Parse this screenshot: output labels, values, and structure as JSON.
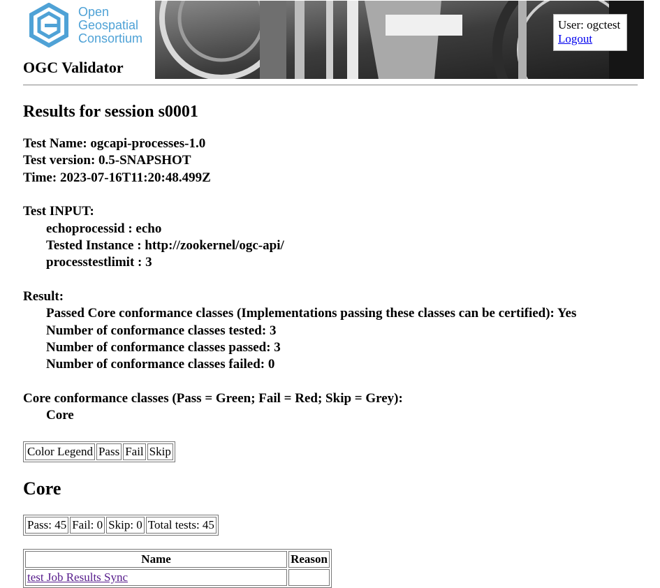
{
  "header": {
    "logo_text": [
      "Open",
      "Geospatial",
      "Consortium"
    ],
    "app_title": "OGC Validator",
    "user_label": "User: ogctest",
    "logout_label": "Logout"
  },
  "session": {
    "title": "Results for session s0001",
    "test_name": "Test Name: ogcapi-processes-1.0",
    "test_version": "Test version: 0.5-SNAPSHOT",
    "time": "Time: 2023-07-16T11:20:48.499Z"
  },
  "input": {
    "heading": "Test INPUT:",
    "params": [
      "echoprocessid : echo",
      "Tested Instance : http://zookernel/ogc-api/",
      "processtestlimit : 3"
    ]
  },
  "result": {
    "heading": "Result:",
    "lines": [
      "Passed Core conformance classes (Implementations passing these classes can be certified): Yes",
      "Number of conformance classes tested: 3",
      "Number of conformance classes passed: 3",
      "Number of conformance classes failed: 0"
    ]
  },
  "core_classes": {
    "heading": "Core conformance classes (Pass = Green; Fail = Red; Skip = Grey):",
    "items": [
      "Core"
    ]
  },
  "legend": [
    "Color Legend",
    "Pass",
    "Fail",
    "Skip"
  ],
  "core": {
    "title": "Core",
    "summary": [
      "Pass: 45",
      "Fail: 0",
      "Skip: 0",
      "Total tests: 45"
    ],
    "columns": [
      "Name",
      "Reason"
    ],
    "rows": [
      {
        "name": "test Job Results Sync",
        "reason": ""
      }
    ]
  },
  "colors": {
    "logo_blue": "#4fa2d6",
    "link": "#0000ee",
    "visited_link": "#551a8b"
  }
}
